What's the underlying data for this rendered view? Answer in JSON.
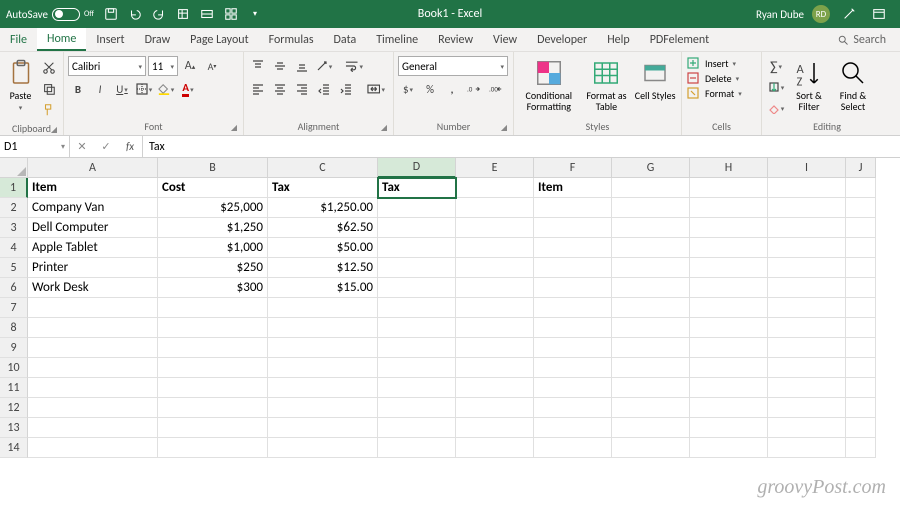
{
  "titlebar": {
    "autosave": "AutoSave",
    "toggle_state": "Off",
    "doc_title": "Book1  -  Excel",
    "user_name": "Ryan Dube",
    "user_initials": "RD"
  },
  "tabs": {
    "file": "File",
    "items": [
      "Home",
      "Insert",
      "Draw",
      "Page Layout",
      "Formulas",
      "Data",
      "Timeline",
      "Review",
      "View",
      "Developer",
      "Help",
      "PDFelement"
    ],
    "active": "Home",
    "search": "Search"
  },
  "ribbon": {
    "clipboard": {
      "paste": "Paste",
      "label": "Clipboard"
    },
    "font": {
      "name": "Calibri",
      "size": "11",
      "label": "Font"
    },
    "alignment": {
      "label": "Alignment"
    },
    "number": {
      "format": "General",
      "label": "Number"
    },
    "styles": {
      "conditional": "Conditional Formatting",
      "formatas": "Format as Table",
      "cellstyles": "Cell Styles",
      "label": "Styles"
    },
    "cells": {
      "insert": "Insert",
      "delete": "Delete",
      "format": "Format",
      "label": "Cells"
    },
    "editing": {
      "sort": "Sort & Filter",
      "find": "Find & Select",
      "label": "Editing"
    }
  },
  "formula_bar": {
    "namebox": "D1",
    "formula": "Tax"
  },
  "columns": [
    "A",
    "B",
    "C",
    "D",
    "E",
    "F",
    "G",
    "H",
    "I",
    "J"
  ],
  "selected_cell": {
    "row": 1,
    "col": "D"
  },
  "row_numbers": [
    1,
    2,
    3,
    4,
    5,
    6,
    7,
    8,
    9,
    10,
    11,
    12,
    13,
    14
  ],
  "cells": {
    "r1": {
      "A": "Item",
      "B": "Cost",
      "C": "Tax",
      "D": "Tax",
      "E": "",
      "F": "Item"
    },
    "r2": {
      "A": "Company Van",
      "B": "$25,000",
      "C": "$1,250.00"
    },
    "r3": {
      "A": "Dell Computer",
      "B": "$1,250",
      "C": "$62.50"
    },
    "r4": {
      "A": "Apple Tablet",
      "B": "$1,000",
      "C": "$50.00"
    },
    "r5": {
      "A": "Printer",
      "B": "$250",
      "C": "$12.50"
    },
    "r6": {
      "A": "Work Desk",
      "B": "$300",
      "C": "$15.00"
    }
  },
  "watermark": "groovyPost.com"
}
